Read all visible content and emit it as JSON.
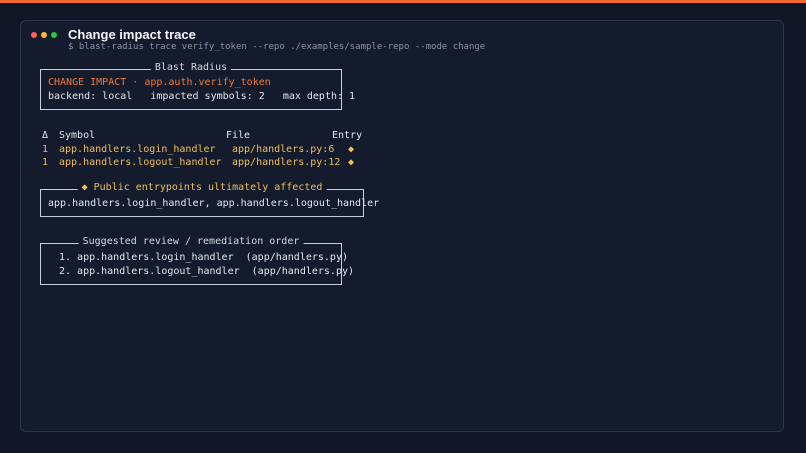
{
  "window": {
    "title": "Change impact trace",
    "command": "$ blast-radius trace verify_token --repo ./examples/sample-repo --mode change"
  },
  "blast_radius": {
    "heading": "Blast Radius",
    "change_line": "CHANGE IMPACT · app.auth.verify_token",
    "backend_label": "backend: local",
    "impacted_label": "impacted symbols: 2",
    "depth_label": "max depth: 1"
  },
  "table": {
    "columns": [
      "Δ",
      "Symbol",
      "File",
      "Entry"
    ],
    "rows": [
      {
        "delta": "1",
        "symbol": "app.handlers.login_handler",
        "file": "app/handlers.py:6",
        "entry": "◆"
      },
      {
        "delta": "1",
        "symbol": "app.handlers.logout_handler",
        "file": "app/handlers.py:12",
        "entry": "◆"
      }
    ]
  },
  "entrypoints": {
    "heading": "◆ Public entrypoints ultimately affected",
    "content": "app.handlers.login_handler, app.handlers.logout_handler"
  },
  "review": {
    "heading": "Suggested review / remediation order",
    "items": [
      "1. app.handlers.login_handler  (app/handlers.py)",
      "2. app.handlers.logout_handler  (app/handlers.py)"
    ]
  },
  "colors": {
    "accent_top": "#f06a2a",
    "change_text": "#f07a3a",
    "highlight": "#f0bf5a",
    "background": "#111726"
  }
}
